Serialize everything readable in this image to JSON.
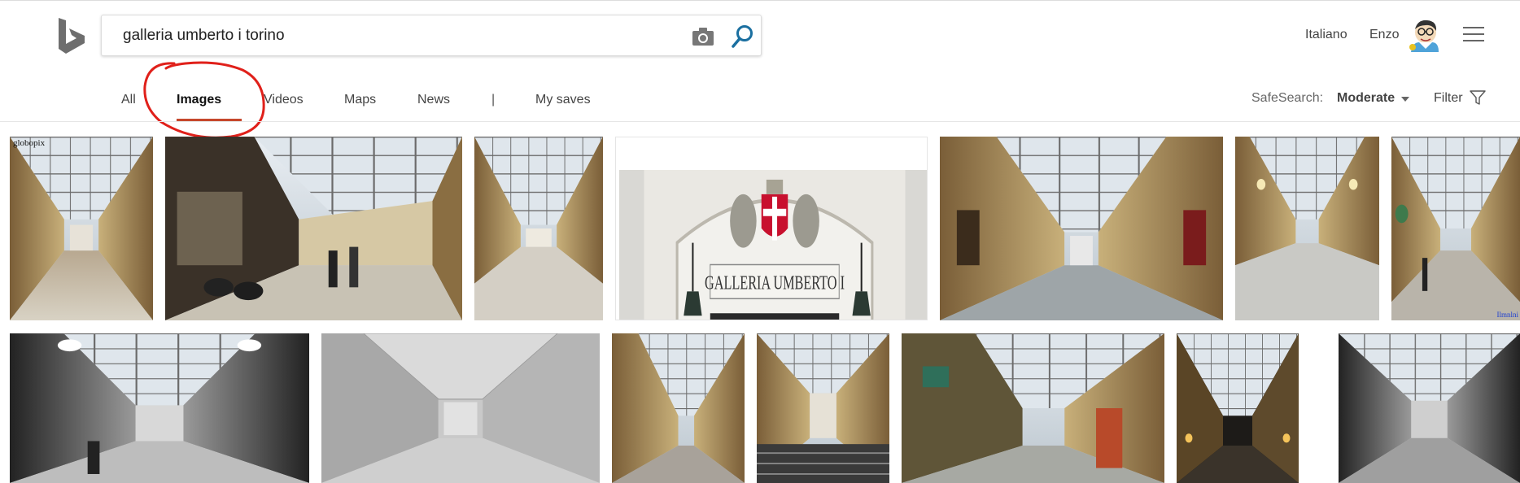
{
  "search": {
    "query": "galleria umberto i torino"
  },
  "header": {
    "language": "Italiano",
    "username": "Enzo"
  },
  "tabs": [
    {
      "label": "All"
    },
    {
      "label": "Images"
    },
    {
      "label": "Videos"
    },
    {
      "label": "Maps"
    },
    {
      "label": "News"
    },
    {
      "label": "My saves"
    }
  ],
  "tab_separator": "|",
  "safesearch": {
    "label": "SafeSearch:",
    "value": "Moderate"
  },
  "filter": {
    "label": "Filter"
  },
  "images": {
    "first_watermark": "globopix",
    "sign_text": "GALLERIA UMBERTO I",
    "last_watermark": "Ilmnlni"
  },
  "colors": {
    "active_tab_underline": "#c6472c",
    "search_icon": "#1a6fa0",
    "annotation_circle": "#e0201a"
  }
}
